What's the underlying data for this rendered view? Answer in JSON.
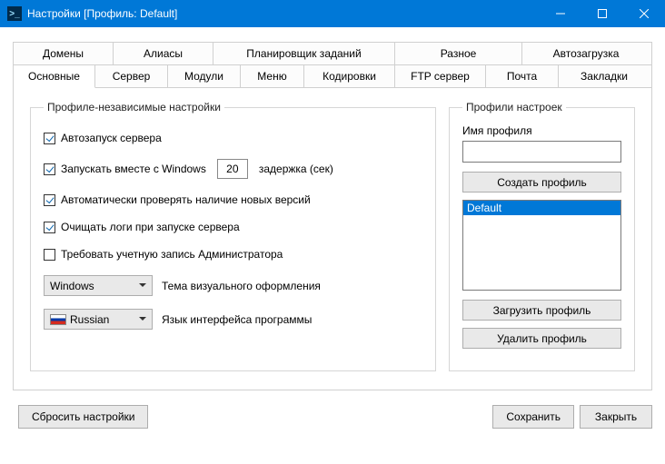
{
  "window": {
    "title": "Настройки [Профиль: Default]"
  },
  "tabs_row1": [
    "Домены",
    "Алиасы",
    "Планировщик заданий",
    "Разное",
    "Автозагрузка"
  ],
  "tabs_row2": [
    "Основные",
    "Сервер",
    "Модули",
    "Меню",
    "Кодировки",
    "FTP сервер",
    "Почта",
    "Закладки"
  ],
  "active_tab": "Основные",
  "left": {
    "legend": "Профиле-независимые настройки",
    "chk_autostart": "Автозапуск сервера",
    "chk_windows": "Запускать вместе с Windows",
    "delay_value": "20",
    "delay_label": "задержка (сек)",
    "chk_update": "Автоматически проверять наличие новых версий",
    "chk_clearlog": "Очищать логи при запуске сервера",
    "chk_admin": "Требовать учетную запись Администратора",
    "theme_value": "Windows",
    "theme_label": "Тема визуального оформления",
    "lang_value": "Russian",
    "lang_label": "Язык интерфейса программы"
  },
  "right": {
    "legend": "Профили настроек",
    "name_label": "Имя профиля",
    "name_value": "",
    "btn_create": "Создать профиль",
    "list": [
      "Default"
    ],
    "btn_load": "Загрузить профиль",
    "btn_delete": "Удалить профиль"
  },
  "footer": {
    "reset": "Сбросить настройки",
    "save": "Сохранить",
    "close": "Закрыть"
  }
}
